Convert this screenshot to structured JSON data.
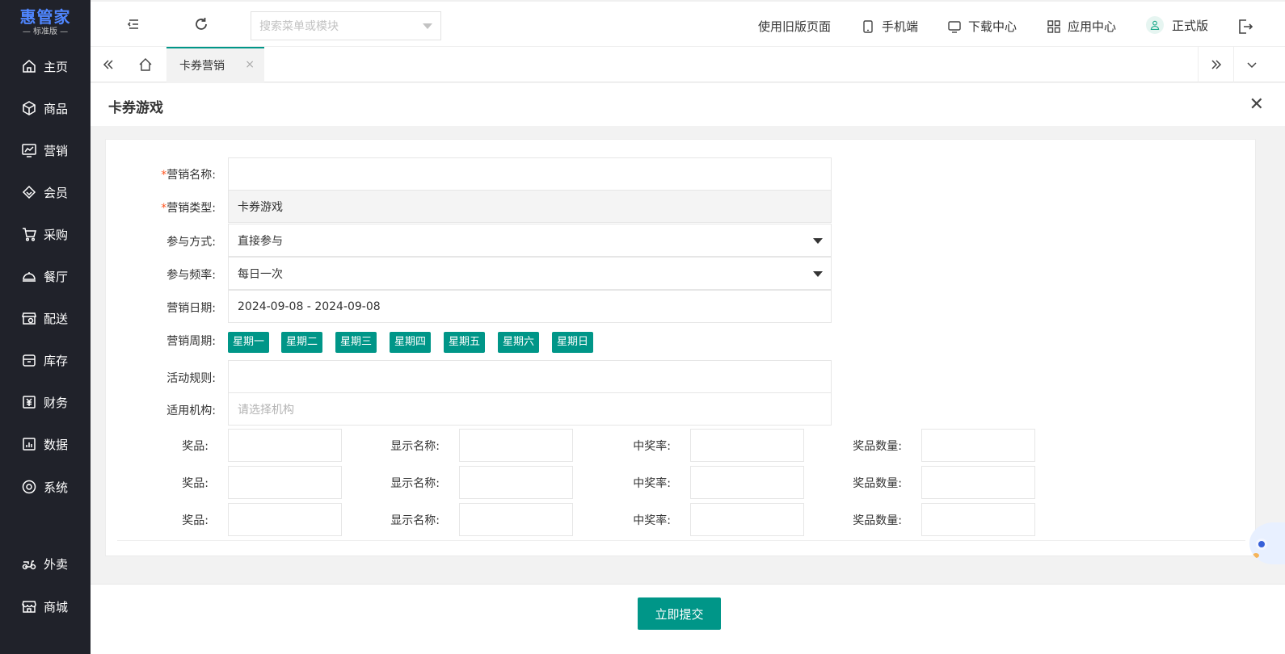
{
  "brand": {
    "name": "惠管家",
    "edition": "— 标准版 —"
  },
  "sidebar": {
    "items": [
      {
        "label": "主页",
        "icon": "home-icon"
      },
      {
        "label": "商品",
        "icon": "box-icon"
      },
      {
        "label": "营销",
        "icon": "chart-icon"
      },
      {
        "label": "会员",
        "icon": "diamond-icon"
      },
      {
        "label": "采购",
        "icon": "cart-icon"
      },
      {
        "label": "餐厅",
        "icon": "cloche-icon"
      },
      {
        "label": "配送",
        "icon": "store-delivery-icon"
      },
      {
        "label": "库存",
        "icon": "inventory-icon"
      },
      {
        "label": "财务",
        "icon": "finance-icon"
      },
      {
        "label": "数据",
        "icon": "data-icon"
      },
      {
        "label": "系统",
        "icon": "settings-icon"
      },
      {
        "label": "外卖",
        "icon": "scooter-icon"
      },
      {
        "label": "商城",
        "icon": "shop-icon"
      }
    ]
  },
  "topbar": {
    "search_placeholder": "搜索菜单或模块",
    "old_page": "使用旧版页面",
    "mobile": "手机端",
    "download": "下载中心",
    "apps": "应用中心",
    "edition": "正式版"
  },
  "tabs": {
    "active_label": "卡券营销",
    "close_glyph": "×"
  },
  "panel": {
    "title": "卡券游戏",
    "close_glyph": "✕"
  },
  "form": {
    "name_label": "营销名称:",
    "type_label": "营销类型:",
    "type_value": "卡券游戏",
    "join_mode_label": "参与方式:",
    "join_mode_value": "直接参与",
    "frequency_label": "参与频率:",
    "frequency_value": "每日一次",
    "date_label": "营销日期:",
    "date_value": "2024-09-08 - 2024-09-08",
    "cycle_label": "营销周期:",
    "weekdays": [
      "星期一",
      "星期二",
      "星期三",
      "星期四",
      "星期五",
      "星期六",
      "星期日"
    ],
    "rules_label": "活动规则:",
    "org_label": "适用机构:",
    "org_placeholder": "请选择机构",
    "required_mark": "*"
  },
  "prizes": {
    "prize_label": "奖品:",
    "display_name_label": "显示名称:",
    "win_rate_label": "中奖率:",
    "quantity_label": "奖品数量:",
    "rows": 3
  },
  "footer": {
    "submit_label": "立即提交"
  },
  "colors": {
    "accent": "#009688",
    "sidebar_bg": "#20222a",
    "brand_blue": "#4f86ff",
    "required": "#ff5722"
  }
}
